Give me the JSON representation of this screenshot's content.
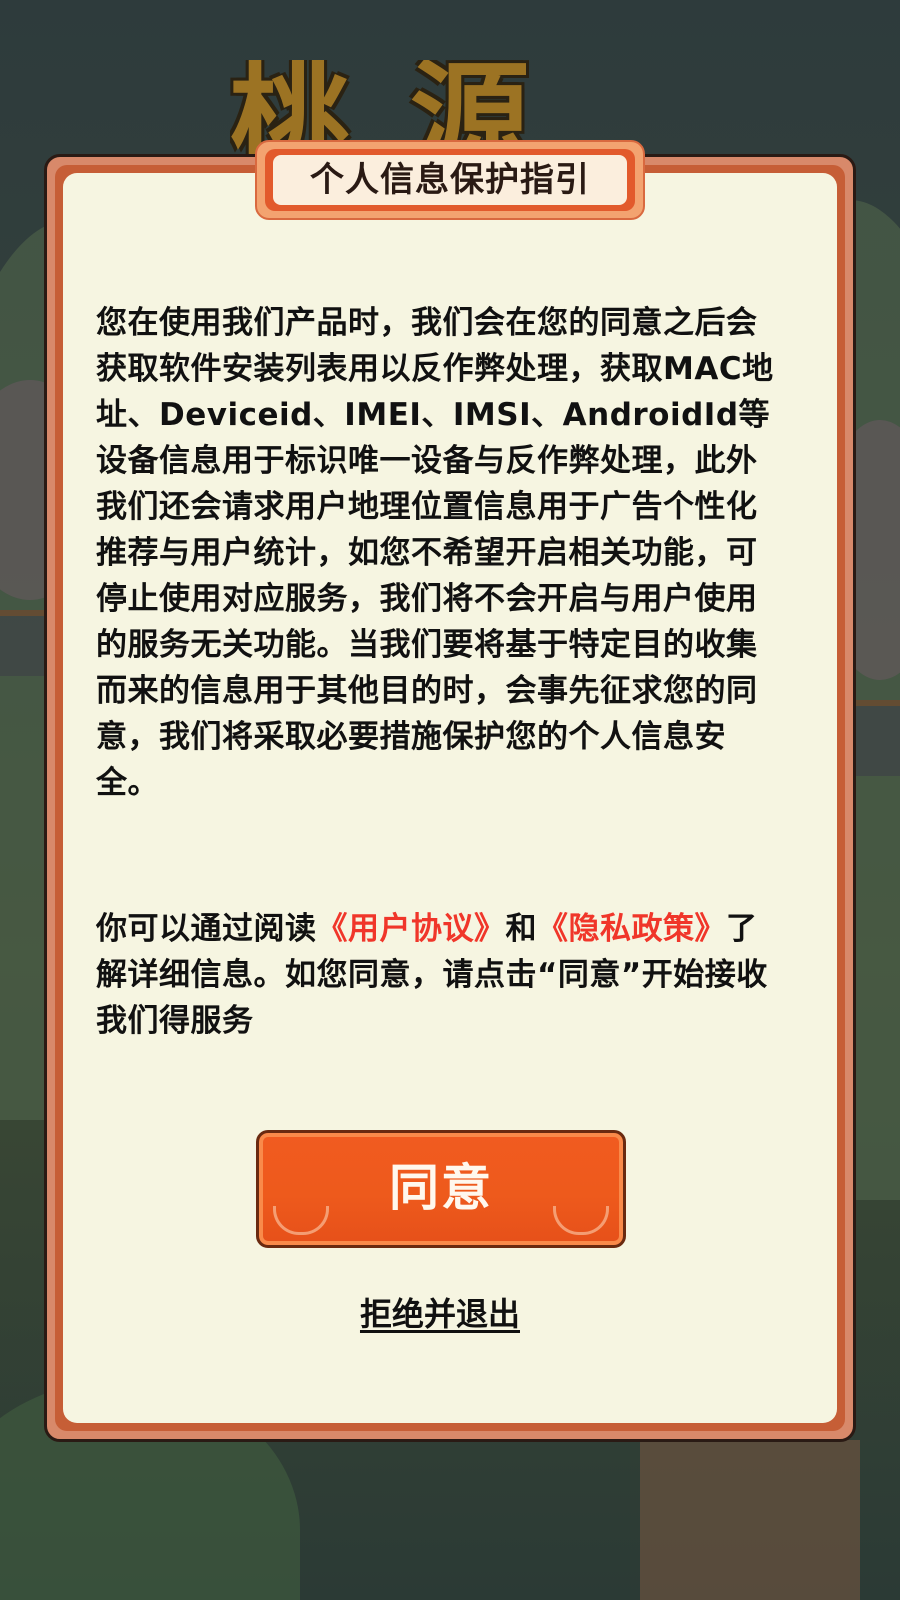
{
  "background": {
    "logo_text": "桃源"
  },
  "dialog": {
    "title": "个人信息保护指引",
    "body": "您在使用我们产品时，我们会在您的同意之后会获取软件安装列表用以反作弊处理，获取MAC地址、Deviceid、IMEI、IMSI、AndroidId等设备信息用于标识唯一设备与反作弊处理，此外我们还会请求用户地理位置信息用于广告个性化推荐与用户统计，如您不希望开启相关功能，可停止使用对应服务，我们将不会开启与用户使用的服务无关功能。当我们要将基于特定目的收集而来的信息用于其他目的时，会事先征求您的同意，我们将采取必要措施保护您的个人信息安全。",
    "link_intro": "你可以通过阅读",
    "user_agreement_link": "《用户协议》",
    "and_text": "和",
    "privacy_policy_link": "《隐私政策》",
    "link_outro": "了解详细信息。如您同意，请点击“同意”开始接收我们得服务",
    "agree_button": "同意",
    "refuse_link": "拒绝并退出"
  },
  "colors": {
    "link": "#f0362a",
    "agree_button": "#ee5a1c",
    "paper": "#f6f5e1",
    "frame": "#c65e36"
  }
}
